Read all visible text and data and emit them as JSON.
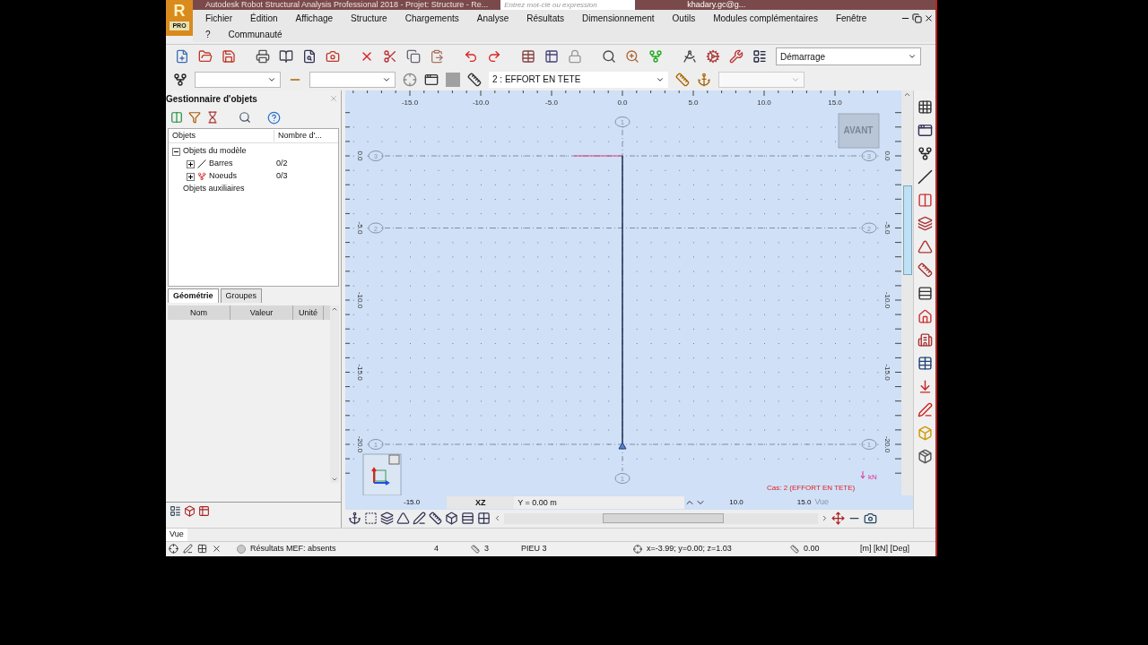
{
  "window": {
    "logo": "R",
    "badge": "PRO",
    "title": "Autodesk Robot Structural Analysis Professional 2018 - Projet: Structure - Re...",
    "search": {
      "placeholder": "Entrez mot-clé ou expression"
    },
    "user": "khadary.gc@g..."
  },
  "menu": [
    [
      "Fichier",
      "Édition",
      "Affichage",
      "Structure",
      "Chargements",
      "Analyse",
      "Résultats",
      "Dimensionnement",
      "Outils",
      "Modules complémentaires",
      "Fenêtre"
    ],
    [
      "?",
      "Communauté"
    ]
  ],
  "toolbar": {
    "layout": "Démarrage",
    "load_case": "2 : EFFORT EN TETE"
  },
  "object_manager": {
    "title": "Gestionnaire d'objets",
    "columns": [
      "Objets",
      "Nombre d'..."
    ],
    "tree": [
      {
        "label": "Objets du modèle",
        "expanded": true,
        "children": [
          {
            "label": "Barres",
            "count": "0/2",
            "expanded": false
          },
          {
            "label": "Noeuds",
            "count": "0/3",
            "expanded": false
          }
        ]
      },
      {
        "label": "Objets auxiliaires"
      }
    ],
    "tabs": [
      {
        "label": "Géométrie",
        "selected": true
      },
      {
        "label": "Groupes",
        "selected": false
      }
    ],
    "property_columns": [
      "Nom",
      "Valeur",
      "Unité"
    ]
  },
  "canvas": {
    "x_ticks": [
      "-15.0",
      "-10.0",
      "-5.0",
      "0.0",
      "5.0",
      "10.0",
      "15.0"
    ],
    "left_ticks": [
      "0.0",
      "-5.0",
      "-10.0",
      "-15.0",
      "-20.0"
    ],
    "right_ticks": [
      "0.0",
      "-5.0",
      "-10.0",
      "-15.0",
      "-20.0"
    ],
    "left_markers": [
      "3",
      "2",
      "1"
    ],
    "right_markers": [
      "3",
      "2",
      "1"
    ],
    "top_marker": "1",
    "bottom_marker": "1",
    "view_label": "AVANT",
    "case_label": "Cas: 2 (EFFORT EN TETE)",
    "unit": "kN",
    "bottom_left_tick": "-15.0",
    "plane": "XZ",
    "coordinate": "Y = 0.00 m",
    "bottom_ticks": [
      "10.0",
      "15.0"
    ],
    "view_name": "Vue"
  },
  "vue_bar": "Vue",
  "status": {
    "fem": "Résultats MEF: absents",
    "field_1": "4",
    "field_2": "3",
    "section": "PIEU 3",
    "cursor": "x=-3.99; y=0.00; z=1.03",
    "angle": "0.00",
    "units": "[m] [kN] [Deg]"
  }
}
